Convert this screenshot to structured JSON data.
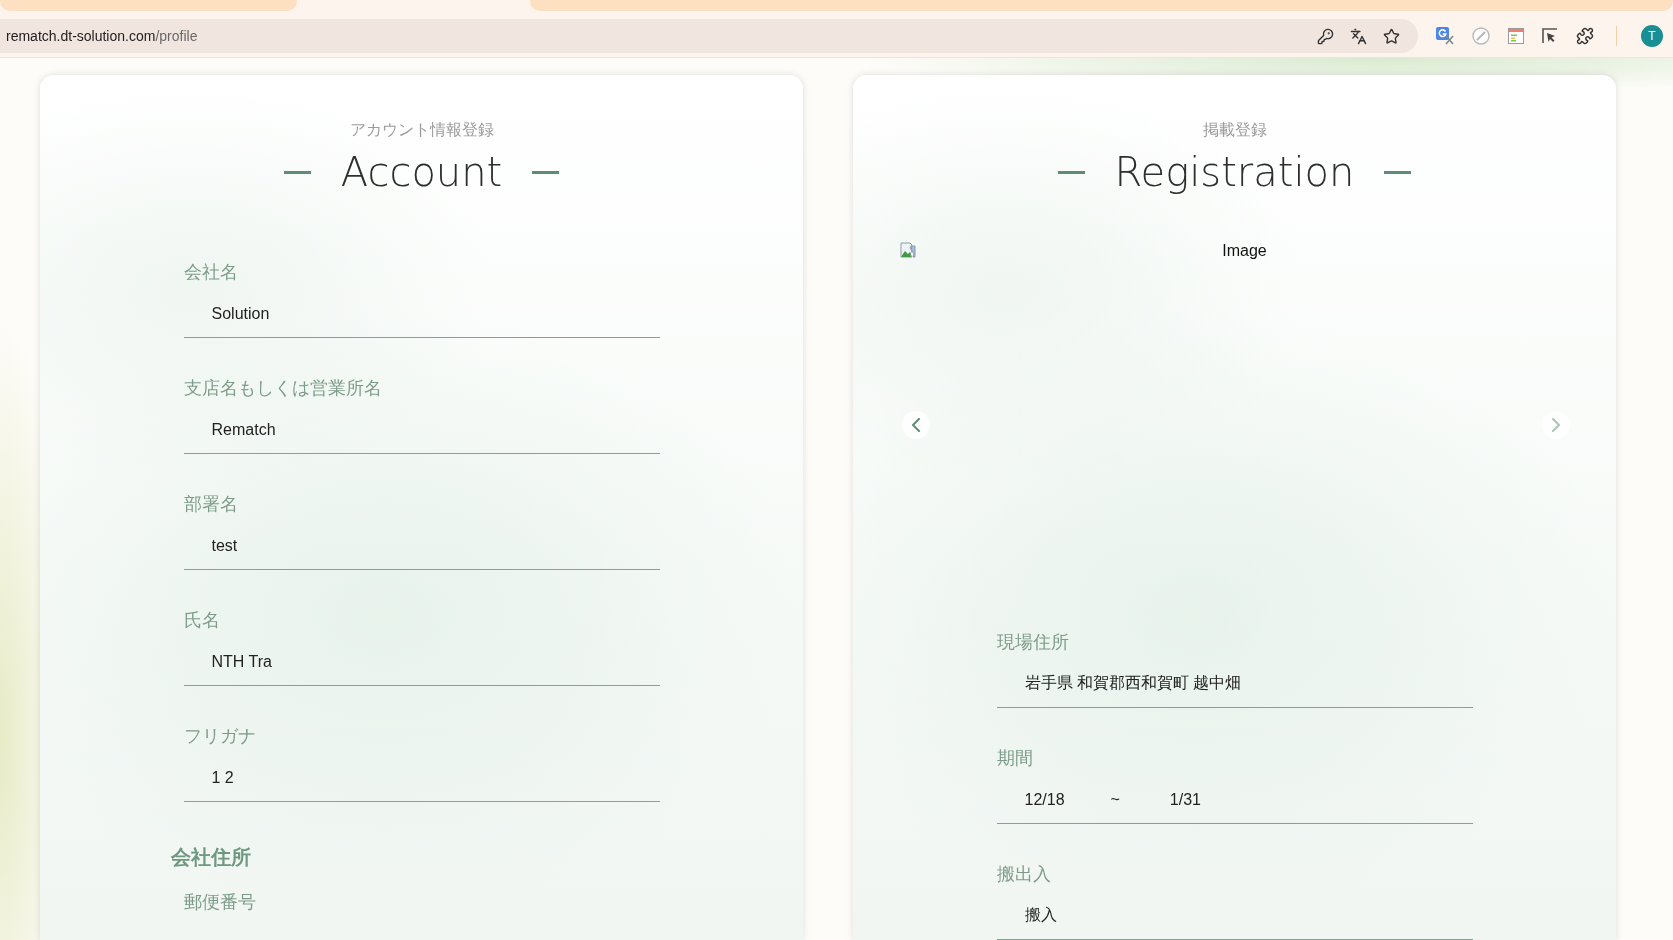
{
  "browser": {
    "address_bar": {
      "host": "rematch.dt-solution.com",
      "path": "/profile"
    },
    "profile_avatar": "T"
  },
  "account": {
    "subtitle": "アカウント情報登録",
    "title": "Account",
    "fields": [
      {
        "label": "会社名",
        "value": "Solution"
      },
      {
        "label": "支店名もしくは営業所名",
        "value": "Rematch"
      },
      {
        "label": "部署名",
        "value": "test"
      },
      {
        "label": "氏名",
        "value": "NTH Tra"
      },
      {
        "label": "フリガナ",
        "value": "1 2"
      }
    ],
    "address_section": {
      "heading": "会社住所",
      "fields": [
        {
          "label": "郵便番号"
        }
      ]
    }
  },
  "registration": {
    "subtitle": "掲載登録",
    "title": "Registration",
    "image": {
      "alt": "Image"
    },
    "carousel_arrows": [
      {
        "kind": "prev",
        "disabled": false
      },
      {
        "kind": "next",
        "disabled": true
      }
    ],
    "fields": [
      {
        "kind": "text",
        "label": "現場住所",
        "value": "岩手県 和賀郡西和賀町 越中畑"
      },
      {
        "kind": "range",
        "label": "期間",
        "from": "12/18",
        "separator": "~",
        "to": "1/31"
      },
      {
        "kind": "text",
        "label": "搬出入",
        "value": "搬入"
      }
    ]
  }
}
